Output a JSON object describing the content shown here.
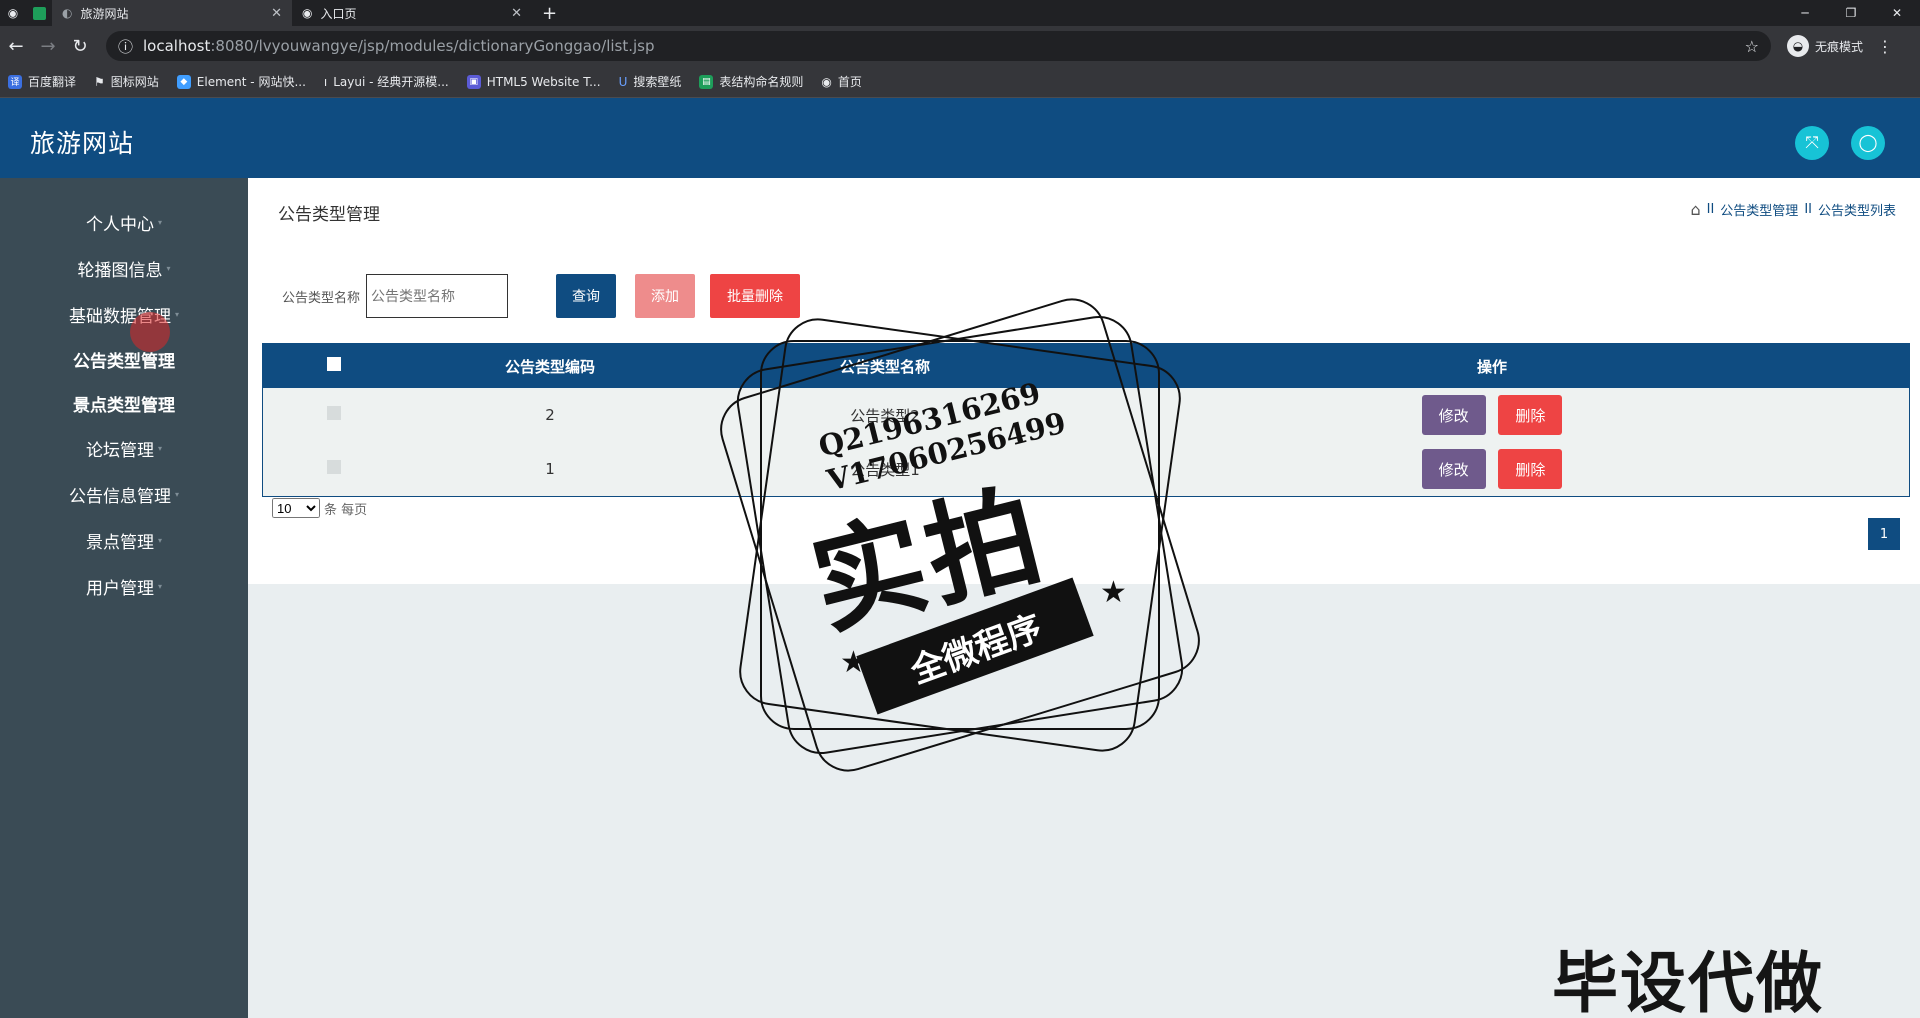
{
  "browser": {
    "tabs": [
      {
        "title": "旅游网站",
        "active": true
      },
      {
        "title": "入口页",
        "active": false
      }
    ],
    "url_host": "localhost",
    "url_rest": ":8080/lvyouwangye/jsp/modules/dictionaryGonggao/list.jsp",
    "incognito_label": "无痕模式",
    "bookmarks": [
      {
        "label": "百度翻译",
        "icon": "translate-icon",
        "color": "#3b6fe0"
      },
      {
        "label": "图标网站",
        "icon": "flag-icon",
        "color": "#444444"
      },
      {
        "label": "Element - 网站快...",
        "icon": "element-icon",
        "color": "#409eff"
      },
      {
        "label": "Layui - 经典开源模...",
        "icon": "layui-icon",
        "color": "#444444"
      },
      {
        "label": "HTML5 Website T...",
        "icon": "html5-icon",
        "color": "#5b5bd6"
      },
      {
        "label": "搜索壁纸",
        "icon": "wallpaper-icon",
        "color": "#2d6cdf"
      },
      {
        "label": "表结构命名规则",
        "icon": "sheet-icon",
        "color": "#1e9e5a"
      },
      {
        "label": "首页",
        "icon": "globe-icon",
        "color": "#666666"
      }
    ]
  },
  "app": {
    "title": "旅游网站"
  },
  "sidebar": {
    "items": [
      {
        "label": "个人中心",
        "bold": false
      },
      {
        "label": "轮播图信息",
        "bold": false
      },
      {
        "label": "基础数据管理",
        "bold": false
      },
      {
        "label": "公告类型管理",
        "bold": true
      },
      {
        "label": "景点类型管理",
        "bold": true
      },
      {
        "label": "论坛管理",
        "bold": false
      },
      {
        "label": "公告信息管理",
        "bold": false
      },
      {
        "label": "景点管理",
        "bold": false
      },
      {
        "label": "用户管理",
        "bold": false
      }
    ]
  },
  "main": {
    "page_title": "公告类型管理",
    "breadcrumb": [
      "公告类型管理",
      "公告类型列表"
    ],
    "search": {
      "label": "公告类型名称",
      "placeholder": "公告类型名称",
      "query_label": "查询",
      "add_label": "添加",
      "batch_delete_label": "批量删除"
    },
    "table": {
      "headers": [
        "公告类型编码",
        "公告类型名称",
        "操作"
      ],
      "rows": [
        {
          "code": "2",
          "name": "公告类型2"
        },
        {
          "code": "1",
          "name": "公告类型1"
        }
      ],
      "edit_label": "修改",
      "delete_label": "删除"
    },
    "pager": {
      "page_size": "10",
      "suffix": "条 每页",
      "current_page": "1"
    }
  },
  "overlay": {
    "stamp_contact_1": "Q2196316269",
    "stamp_contact_2": "V17060256499",
    "stamp_big": "实拍",
    "stamp_ribbon": "全微程序",
    "corner_text": "毕设代做"
  }
}
